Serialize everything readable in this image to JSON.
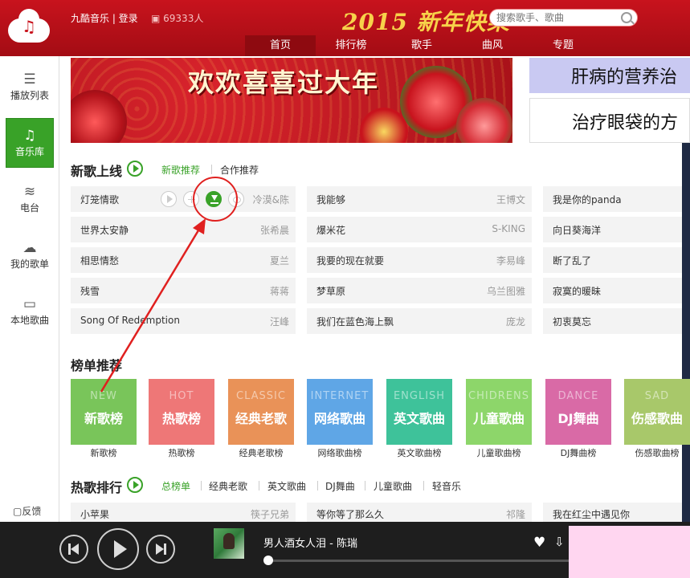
{
  "header": {
    "brand": "九酷音乐 | 登录",
    "online_count": "69333人",
    "banner_art": "2015 新年快樂",
    "search_placeholder": "搜索歌手、歌曲",
    "nav": [
      "首页",
      "排行榜",
      "歌手",
      "曲风",
      "专题"
    ],
    "active_nav": "首页"
  },
  "sidebar": {
    "items": [
      {
        "label": "播放列表",
        "icon": "list-icon"
      },
      {
        "label": "音乐库",
        "icon": "music-note-icon"
      },
      {
        "label": "电台",
        "icon": "wifi-icon"
      },
      {
        "label": "我的歌单",
        "icon": "cloud-icon"
      },
      {
        "label": "本地歌曲",
        "icon": "monitor-icon"
      }
    ],
    "active": "音乐库",
    "feedback": "反馈"
  },
  "banners": {
    "main_title": "欢欢喜喜过大年",
    "side_ad_1": "肝病的营养治",
    "side_ad_2": "治疗眼袋的方"
  },
  "new_songs": {
    "title": "新歌上线",
    "tabs": [
      "新歌推荐",
      "合作推荐"
    ],
    "active_tab": "新歌推荐",
    "columns": [
      [
        {
          "title": "灯笼情歌",
          "artist": "冷漠&陈"
        },
        {
          "title": "世界太安静",
          "artist": "张希晨"
        },
        {
          "title": "相思情愁",
          "artist": "夏兰"
        },
        {
          "title": "残雪",
          "artist": "蒋蒋"
        },
        {
          "title": "Song Of Redemption",
          "artist": "汪峰"
        }
      ],
      [
        {
          "title": "我能够",
          "artist": "王博文"
        },
        {
          "title": "爆米花",
          "artist": "S-KING"
        },
        {
          "title": "我要的现在就要",
          "artist": "李易峰"
        },
        {
          "title": "梦草原",
          "artist": "乌兰图雅"
        },
        {
          "title": "我们在蓝色海上飘",
          "artist": "庞龙"
        }
      ],
      [
        {
          "title": "我是你的panda",
          "artist": ""
        },
        {
          "title": "向日葵海洋",
          "artist": ""
        },
        {
          "title": "断了乱了",
          "artist": ""
        },
        {
          "title": "寂寞的暖昧",
          "artist": ""
        },
        {
          "title": "初衷莫忘",
          "artist": ""
        }
      ]
    ]
  },
  "charts": {
    "title": "榜单推荐",
    "cards": [
      {
        "en": "NEW",
        "cn": "新歌榜",
        "label": "新歌榜",
        "color": "#79c55a"
      },
      {
        "en": "HOT",
        "cn": "热歌榜",
        "label": "热歌榜",
        "color": "#ee7777"
      },
      {
        "en": "CLASSIC",
        "cn": "经典老歌",
        "label": "经典老歌榜",
        "color": "#e99258"
      },
      {
        "en": "INTERNET",
        "cn": "网络歌曲",
        "label": "网络歌曲榜",
        "color": "#5fa6e6"
      },
      {
        "en": "ENGLISH",
        "cn": "英文歌曲",
        "label": "英文歌曲榜",
        "color": "#3ec29a"
      },
      {
        "en": "CHIDRENS",
        "cn": "儿童歌曲",
        "label": "儿童歌曲榜",
        "color": "#8dd66a"
      },
      {
        "en": "DANCE",
        "cn": "DJ舞曲",
        "label": "DJ舞曲榜",
        "color": "#d96aa6"
      },
      {
        "en": "SAD",
        "cn": "伤感歌曲",
        "label": "伤感歌曲榜",
        "color": "#a8c86a"
      }
    ]
  },
  "hot": {
    "title": "热歌排行",
    "tabs": [
      "总榜单",
      "经典老歌",
      "英文歌曲",
      "DJ舞曲",
      "儿童歌曲",
      "轻音乐"
    ],
    "active_tab": "总榜单",
    "rows": [
      {
        "title": "小苹果",
        "artist": "筷子兄弟"
      },
      {
        "title": "等你等了那么久",
        "artist": "祁隆"
      },
      {
        "title": "我在红尘中遇见你",
        "artist": ""
      }
    ]
  },
  "player": {
    "now_playing": "男人酒女人泪 - 陈瑞",
    "progress": 0
  }
}
